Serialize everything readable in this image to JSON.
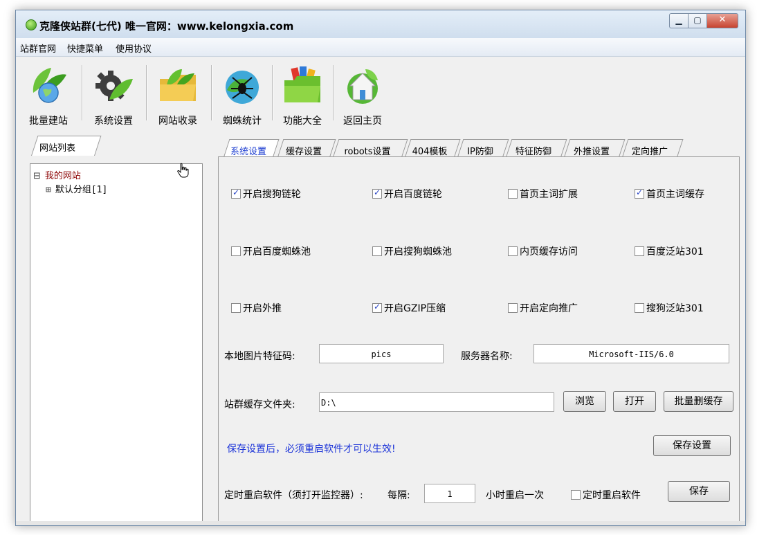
{
  "window": {
    "title": "克隆侠站群(七代) 唯一官网：www.kelongxia.com",
    "controls": {
      "minimize": "▁",
      "maximize": "▢",
      "close": "✕"
    }
  },
  "menu": [
    "站群官网",
    "快捷菜单",
    "使用协议"
  ],
  "toolbar": [
    {
      "label": "批量建站",
      "icon": "leaf-globe-icon"
    },
    {
      "label": "系统设置",
      "icon": "gear-leaf-icon"
    },
    {
      "label": "网站收录",
      "icon": "folder-leaf-icon"
    },
    {
      "label": "蜘蛛统计",
      "icon": "spider-icon"
    },
    {
      "label": "功能大全",
      "icon": "folder-colorful-icon"
    },
    {
      "label": "返回主页",
      "icon": "home-icon"
    }
  ],
  "left_panel": {
    "tab": "网站列表",
    "tree": {
      "root": {
        "label": "我的网站",
        "toggle": "⊟"
      },
      "child": {
        "label": "默认分组[1]",
        "toggle": "⊞"
      }
    }
  },
  "tabs": [
    "系统设置",
    "缓存设置",
    "robots设置",
    "404模板",
    "IP防御",
    "特征防御",
    "外推设置",
    "定向推广"
  ],
  "active_tab": 0,
  "checkboxes": [
    {
      "label": "开启搜狗链轮",
      "checked": true
    },
    {
      "label": "开启百度链轮",
      "checked": true
    },
    {
      "label": "首页主词扩展",
      "checked": false
    },
    {
      "label": "首页主词缓存",
      "checked": true
    },
    {
      "label": "开启百度蜘蛛池",
      "checked": false
    },
    {
      "label": "开启搜狗蜘蛛池",
      "checked": false
    },
    {
      "label": "内页缓存访问",
      "checked": false
    },
    {
      "label": "百度泛站301",
      "checked": false
    },
    {
      "label": "开启外推",
      "checked": false
    },
    {
      "label": "开启GZIP压缩",
      "checked": true
    },
    {
      "label": "开启定向推广",
      "checked": false
    },
    {
      "label": "搜狗泛站301",
      "checked": false
    }
  ],
  "form": {
    "image_code_label": "本地图片特征码:",
    "image_code_value": "pics",
    "server_name_label": "服务器名称:",
    "server_name_value": "Microsoft-IIS/6.0",
    "cache_folder_label": "站群缓存文件夹:",
    "cache_folder_value": "D:\\",
    "browse_button": "浏览",
    "open_button": "打开",
    "batch_delete_button": "批量删缓存",
    "notice": "保存设置后，必须重启软件才可以生效!",
    "save_settings_button": "保存设置",
    "restart_label": "定时重启软件（须打开监控器）:",
    "interval_label": "每隔:",
    "interval_value": "1",
    "interval_unit": "小时重启一次",
    "restart_checkbox": {
      "label": "定时重启软件",
      "checked": false
    },
    "save_button": "保存"
  },
  "colors": {
    "tab_active_text": "#1a3bd0",
    "notice_text": "#1a32d8",
    "tree_root_text": "#8b0000",
    "check_mark": "#2a45c4"
  }
}
